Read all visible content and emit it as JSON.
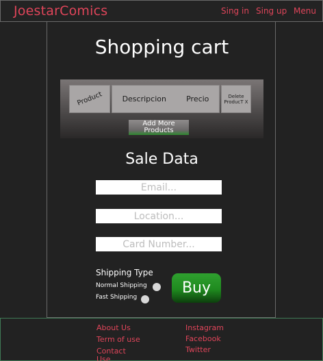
{
  "header": {
    "brand": "JoestarComics",
    "nav": [
      "Sing in",
      "Sing up",
      "Menu"
    ]
  },
  "cart": {
    "title": "Shopping cart",
    "columns": {
      "product": "Product",
      "description": "Descripcion",
      "price": "Precio",
      "delete": "Delete ProducT X"
    },
    "add_more_label": "Add More Products"
  },
  "sale": {
    "title": "Sale Data",
    "email_placeholder": "Email...",
    "location_placeholder": "Location...",
    "card_placeholder": "Card Number..."
  },
  "shipping": {
    "title": "Shipping Type",
    "options": [
      "Normal Shipping",
      "Fast Shipping"
    ]
  },
  "buy_label": "Buy",
  "footer": {
    "left_links": [
      "About Us",
      "Term of use",
      "Contact Use"
    ],
    "right_links": [
      "Instagram",
      "Facebook",
      "Twitter"
    ]
  },
  "colors": {
    "accent": "#e0455a",
    "background": "#222222",
    "buy_green": "#1f8a1f"
  }
}
